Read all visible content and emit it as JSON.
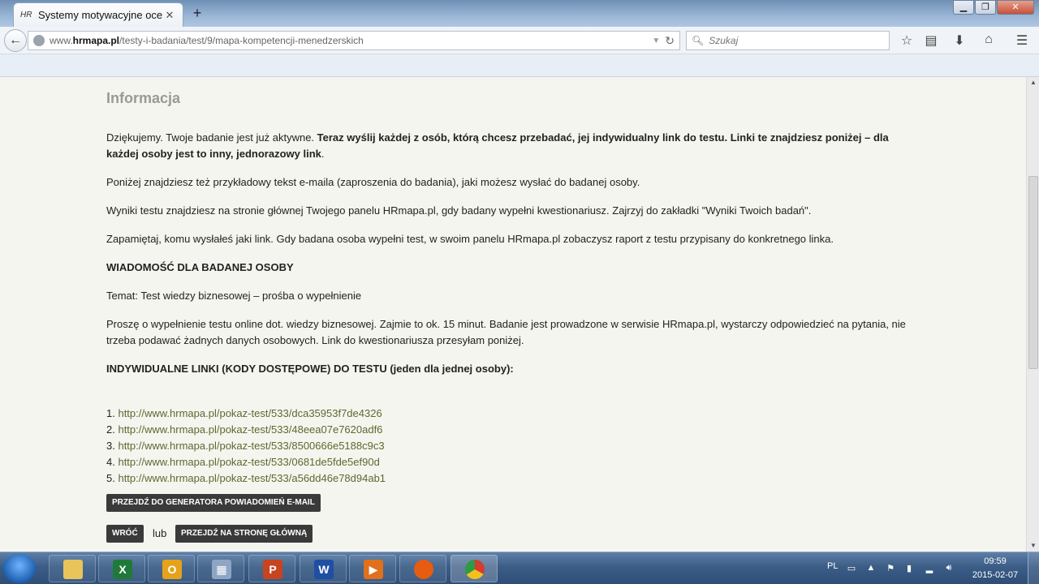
{
  "browser": {
    "tab": {
      "favicon": "HR",
      "title": "Systemy motywacyjne oce...",
      "close": "✕"
    },
    "new_tab": "+",
    "window_buttons": {
      "minimize": "▁",
      "maximize": "❐",
      "close": "✕"
    },
    "url": {
      "prefix": "www.",
      "domain": "hrmapa.pl",
      "path": "/testy-i-badania/test/9/mapa-kompetencji-menedzerskich"
    },
    "search_placeholder": "Szukaj",
    "icons": [
      "star-icon",
      "reading-list-icon",
      "download-icon",
      "home-icon",
      "menu-icon"
    ]
  },
  "page": {
    "heading": "Informacja",
    "intro_normal": "Dziękujemy. Twoje badanie jest już aktywne. ",
    "intro_bold": "Teraz wyślij każdej z osób, którą chcesz przebadać, jej indywidualny link do testu. Linki te znajdziesz poniżej – dla każdej osoby jest to inny, jednorazowy link",
    "intro_end": ".",
    "p2": "Poniżej znajdziesz też przykładowy tekst e-maila (zaproszenia do badania), jaki możesz wysłać do badanej osoby.",
    "p3": "Wyniki testu znajdziesz na stronie głównej Twojego panelu HRmapa.pl, gdy badany wypełni kwestionariusz. Zajrzyj do zakładki \"Wyniki Twoich badań\".",
    "p4": "Zapamiętaj, komu wysłałeś jaki link. Gdy badana osoba wypełni test, w swoim panelu HRmapa.pl zobaczysz raport z testu przypisany do konkretnego linka.",
    "message_heading": "WIADOMOŚĆ DLA BADANEJ OSOBY",
    "subject": "Temat: Test wiedzy biznesowej – prośba o wypełnienie",
    "body_text": "Proszę o wypełnienie testu online dot. wiedzy biznesowej. Zajmie to ok. 15 minut. Badanie jest prowadzone w serwisie HRmapa.pl, wystarczy odpowiedzieć na pytania, nie trzeba podawać żadnych danych osobowych. Link do kwestionariusza  przesyłam poniżej.",
    "links_heading": "INDYWIDUALNE LINKI (KODY DOSTĘPOWE) DO TESTU (jeden dla jednej osoby):",
    "links": [
      {
        "num": "1. ",
        "url": "http://www.hrmapa.pl/pokaz-test/533/dca35953f7de4326"
      },
      {
        "num": "2. ",
        "url": "http://www.hrmapa.pl/pokaz-test/533/48eea07e7620adf6"
      },
      {
        "num": "3. ",
        "url": "http://www.hrmapa.pl/pokaz-test/533/8500666e5188c9c3"
      },
      {
        "num": "4. ",
        "url": "http://www.hrmapa.pl/pokaz-test/533/0681de5fde5ef90d"
      },
      {
        "num": "5. ",
        "url": "http://www.hrmapa.pl/pokaz-test/533/a56dd46e78d94ab1"
      }
    ],
    "generator_button": "PRZEJDŹ DO GENERATORA POWIADOMIEŃ E-MAIL",
    "back_button": "WRÓĆ",
    "or_text": "lub",
    "home_button": "PRZEJDŹ NA STRONĘ GŁÓWNĄ"
  },
  "taskbar": {
    "apps": [
      "explorer-icon",
      "excel-icon",
      "outlook-icon",
      "calculator-icon",
      "powerpoint-icon",
      "word-icon",
      "media-player-icon",
      "firefox-icon",
      "chrome-icon"
    ],
    "language": "PL",
    "time": "09:59",
    "date": "2015-02-07"
  }
}
